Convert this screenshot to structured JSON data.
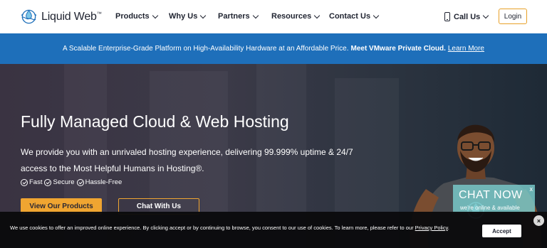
{
  "header": {
    "logo_text": "Liquid Web",
    "logo_tm": "™",
    "nav": [
      "Products",
      "Why Us",
      "Partners",
      "Resources",
      "Contact Us"
    ],
    "call_label": "Call Us",
    "login_label": "Login"
  },
  "banner": {
    "text": "A Scalable Enterprise-Grade Platform on High-Availability Hardware at an Affordable Price.",
    "bold": "Meet VMware Private Cloud.",
    "link": "Learn More"
  },
  "hero": {
    "title": "Fully Managed Cloud & Web Hosting",
    "subtitle": "We provide you with an unrivaled hosting experience, delivering 99.999% uptime & 24/7 access to the Most Helpful Humans in Hosting®.",
    "features": [
      "Fast",
      "Secure",
      "Hassle-Free"
    ],
    "primary_button": "View Our Products",
    "secondary_button": "Chat With Us"
  },
  "chat_widget": {
    "title": "CHAT NOW",
    "subtitle": "we're online & available",
    "close": "x"
  },
  "cookie": {
    "text": "We use cookies to offer an improved online experience. By clicking accept or by continuing to browse, you consent to our use of cookies. To learn more, please refer to our",
    "link": "Privacy Policy",
    "period": ".",
    "accept_label": "Accept",
    "close": "×"
  },
  "colors": {
    "accent": "#f0a531",
    "banner": "#1e6fba",
    "chat": "#78c8c8"
  },
  "icons": [
    "liquid-web-logo-icon",
    "chevron-down-icon",
    "phone-icon",
    "check-circle-icon",
    "close-icon"
  ]
}
